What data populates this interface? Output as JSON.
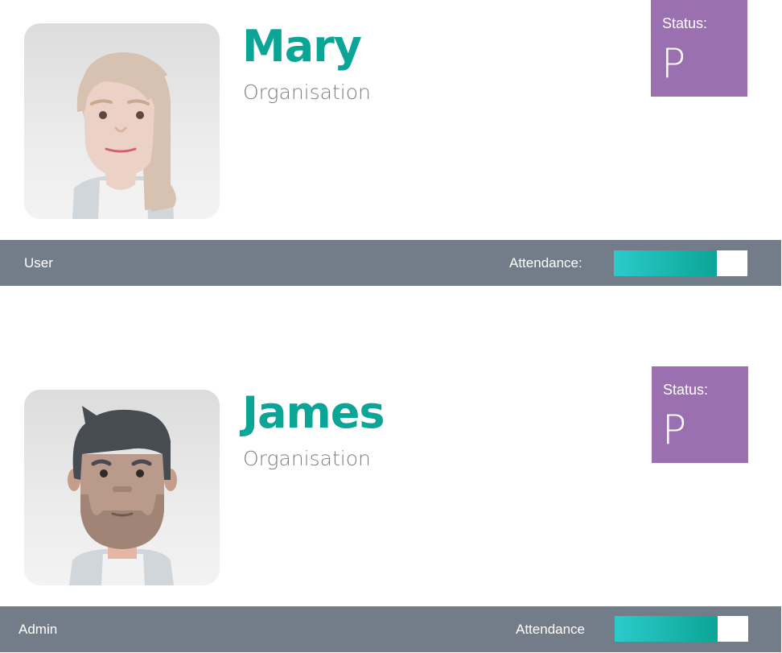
{
  "colors": {
    "name": "#0aa596",
    "status_bg": "#9b70b1",
    "bar_bg": "#737d89",
    "progress_start": "#2ccbcb",
    "progress_end": "#0aa596"
  },
  "profiles": [
    {
      "name": "Mary",
      "organisation": "Organisation",
      "status_label": "Status:",
      "status_value": "P",
      "role": "User",
      "attendance_label": "Attendance:",
      "attendance_fraction": 0.77,
      "avatar_icon": "woman-avatar-icon"
    },
    {
      "name": "James",
      "organisation": "Organisation",
      "status_label": "Status:",
      "status_value": "P",
      "role": "Admin",
      "attendance_label": "Attendance",
      "attendance_fraction": 0.77,
      "avatar_icon": "man-avatar-icon"
    }
  ]
}
